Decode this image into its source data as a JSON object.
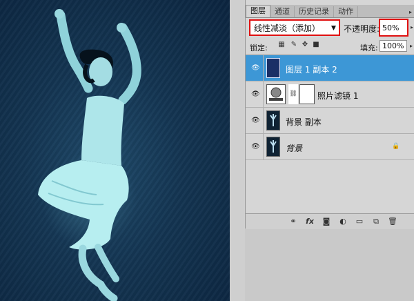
{
  "tabs": [
    {
      "label": "图层",
      "active": true
    },
    {
      "label": "通道",
      "active": false
    },
    {
      "label": "历史记录",
      "active": false
    },
    {
      "label": "动作",
      "active": false
    }
  ],
  "blend_mode": "线性减淡（添加）",
  "opacity": {
    "label": "不透明度:",
    "value": "50%"
  },
  "lock": {
    "label": "锁定:",
    "icons": [
      "lock-transparent-icon",
      "lock-paint-icon",
      "lock-move-icon",
      "lock-all-icon"
    ]
  },
  "fill": {
    "label": "填充:",
    "value": "100%"
  },
  "layers": [
    {
      "name": "图层 1 副本 2",
      "selected": true,
      "visible": true,
      "thumb": "solid-blue",
      "locked": false
    },
    {
      "name": "照片滤镜 1",
      "selected": false,
      "visible": true,
      "thumb": "adjustment",
      "locked": false
    },
    {
      "name": "背景 副本",
      "selected": false,
      "visible": true,
      "thumb": "photo",
      "locked": false
    },
    {
      "name": "背景",
      "selected": false,
      "visible": true,
      "thumb": "photo",
      "locked": true
    }
  ],
  "bottom_icons": [
    "link-icon",
    "fx-icon",
    "mask-icon",
    "adjustment-icon",
    "group-icon",
    "new-layer-icon",
    "trash-icon"
  ],
  "colors": {
    "selected_layer": "#3d97d6",
    "highlight_border": "#e01010",
    "panel_bg": "#d6d6d6"
  }
}
